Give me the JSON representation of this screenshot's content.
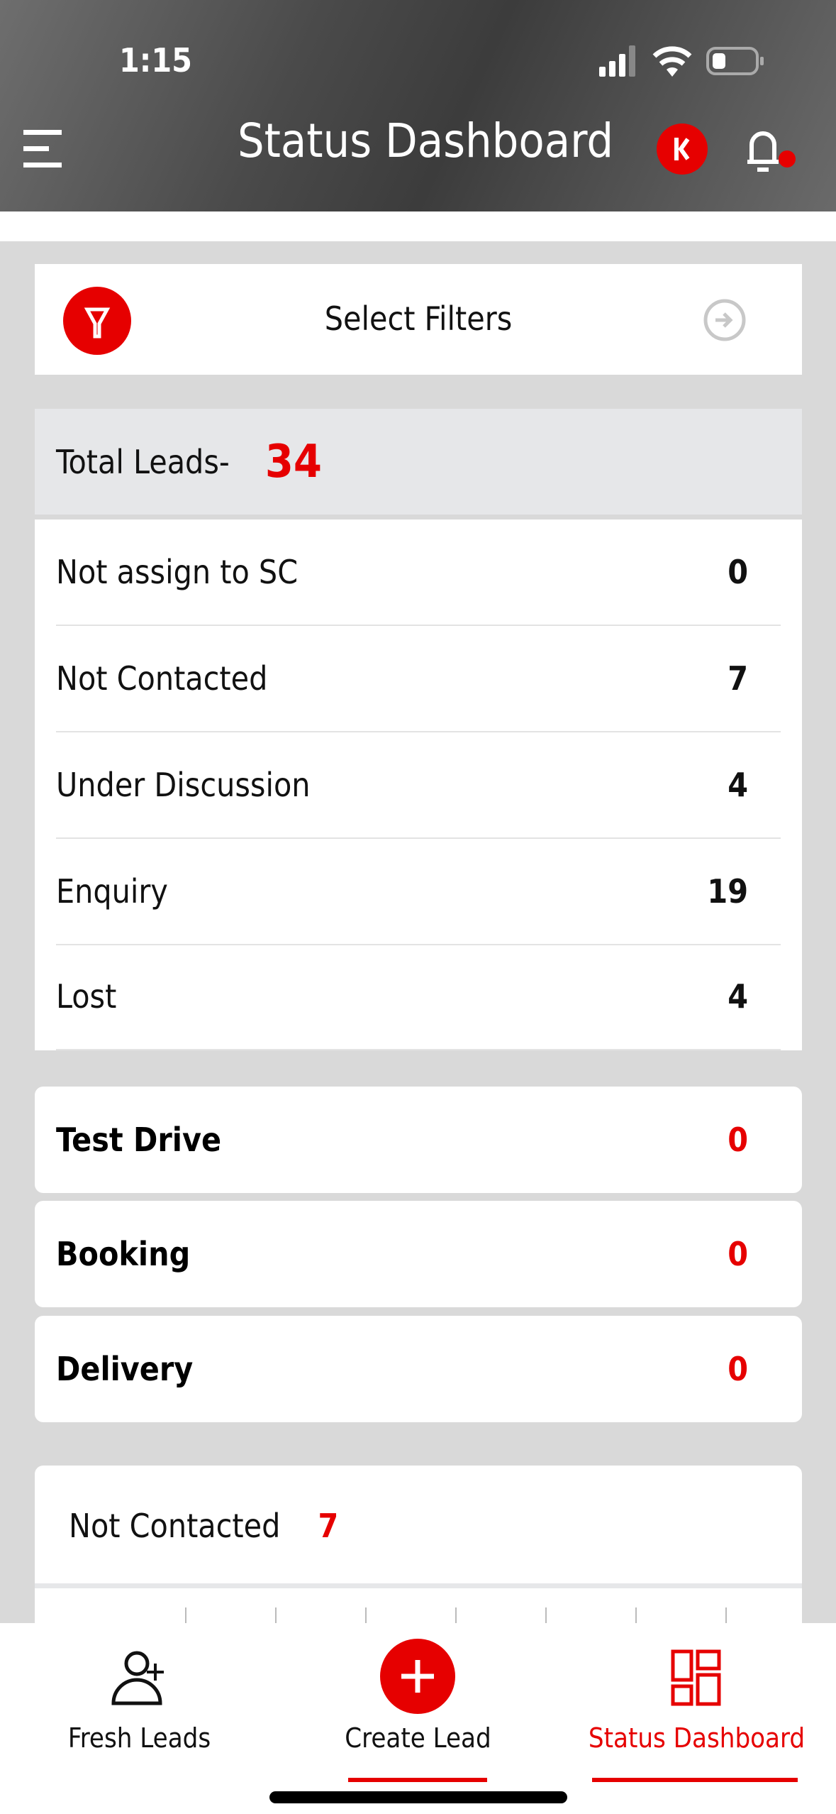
{
  "status_bar": {
    "time": "1:15"
  },
  "header": {
    "title": "Status Dashboard",
    "menu_icon": "hamburger-icon",
    "brand_icon": "brand-logo-icon",
    "notification_icon": "bell-icon"
  },
  "filters": {
    "label": "Select Filters",
    "icon": "filter-icon",
    "go_icon": "arrow-right-circle-icon"
  },
  "total": {
    "label": "Total Leads-",
    "value": "34"
  },
  "rows": [
    {
      "label": "Not assign to SC",
      "value": "0"
    },
    {
      "label": "Not Contacted",
      "value": "7"
    },
    {
      "label": "Under Discussion",
      "value": "4"
    },
    {
      "label": "Enquiry",
      "value": "19"
    },
    {
      "label": "Lost",
      "value": "4"
    }
  ],
  "stages": [
    {
      "label": "Test Drive",
      "value": "0"
    },
    {
      "label": "Booking",
      "value": "0"
    },
    {
      "label": "Delivery",
      "value": "0"
    }
  ],
  "detail": {
    "label": "Not Contacted",
    "value": "7"
  },
  "nav": [
    {
      "label": "Fresh Leads",
      "icon": "add-user-icon"
    },
    {
      "label": "Create Lead",
      "icon": "plus-circle-icon"
    },
    {
      "label": "Status Dashboard",
      "icon": "dashboard-icon",
      "active": true
    }
  ],
  "colors": {
    "accent": "#e60000",
    "background": "#d9d9d9",
    "total_bg": "#e6e7e9"
  }
}
